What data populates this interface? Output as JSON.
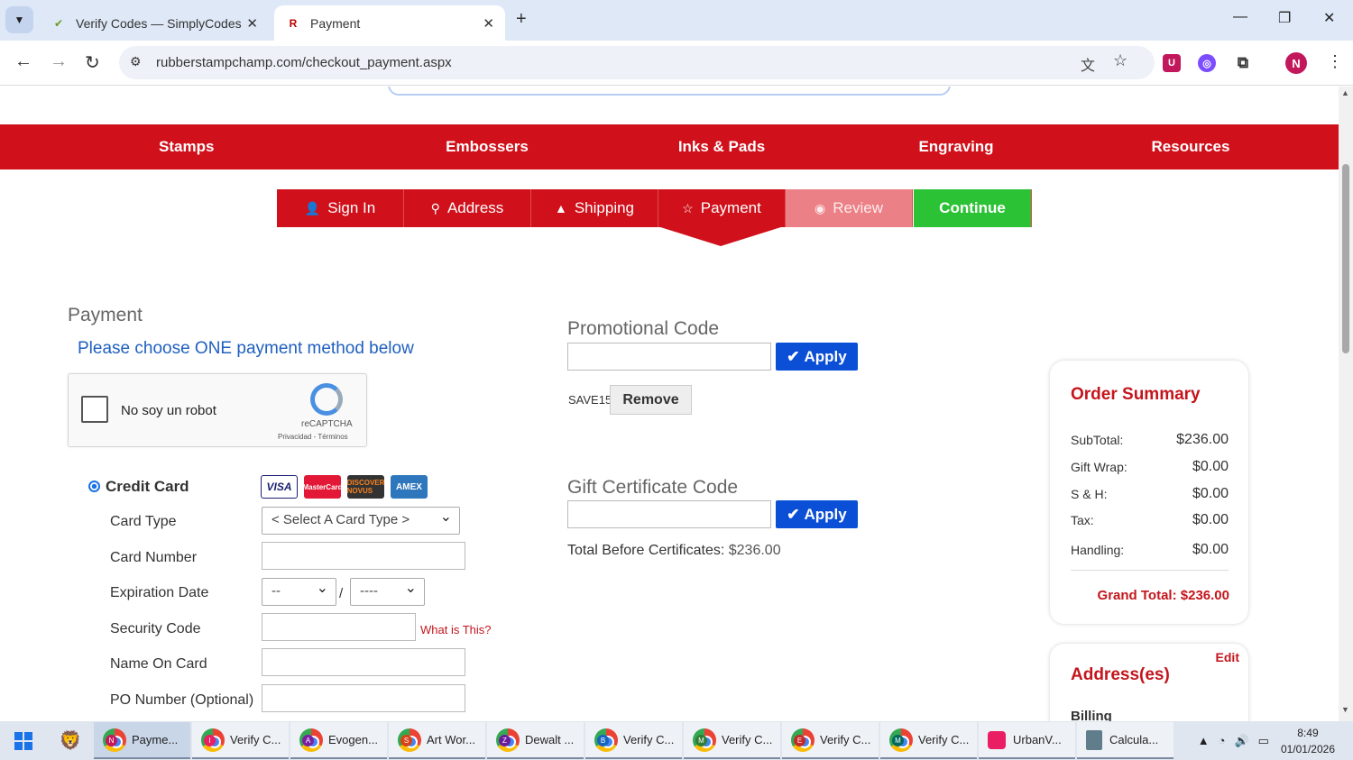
{
  "browser": {
    "tabs": [
      {
        "title": "Verify Codes — SimplyCodes",
        "active": false
      },
      {
        "title": "Payment",
        "active": true
      }
    ],
    "url": "rubberstampchamp.com/checkout_payment.aspx",
    "profile_initial": "N"
  },
  "nav": {
    "items": [
      "Stamps",
      "Embossers",
      "Inks & Pads",
      "Engraving",
      "Resources"
    ]
  },
  "steps": {
    "sign_in": "Sign In",
    "address": "Address",
    "shipping": "Shipping",
    "payment": "Payment",
    "review": "Review",
    "continue": "Continue"
  },
  "payment": {
    "heading": "Payment",
    "instruction": "Please choose ONE payment method below",
    "recaptcha_label": "No soy un robot",
    "recaptcha_brand": "reCAPTCHA",
    "recaptcha_links": "Privacidad - Términos",
    "credit_card_label": "Credit Card",
    "card_logos": [
      "VISA",
      "MasterCard",
      "DISCOVER NOVUS",
      "AMEX"
    ],
    "fields": {
      "card_type_label": "Card Type",
      "card_type_value": "< Select A Card Type >",
      "card_number_label": "Card Number",
      "expiration_label": "Expiration Date",
      "exp_month_value": "--",
      "exp_year_value": "----",
      "security_code_label": "Security Code",
      "what_is_this": "What is This?",
      "name_on_card_label": "Name On Card",
      "po_number_label": "PO Number (Optional)"
    }
  },
  "promo": {
    "heading": "Promotional Code",
    "apply_label": "Apply",
    "applied_code": "SAVE15",
    "remove_label": "Remove"
  },
  "gift": {
    "heading": "Gift Certificate Code",
    "apply_label": "Apply",
    "total_before_label": "Total Before Certificates:",
    "total_before_value": "$236.00"
  },
  "summary": {
    "heading": "Order Summary",
    "rows": [
      {
        "label": "SubTotal:",
        "value": "$236.00"
      },
      {
        "label": "Gift Wrap:",
        "value": "$0.00"
      },
      {
        "label": "S & H:",
        "value": "$0.00"
      },
      {
        "label": "Tax:",
        "value": "$0.00"
      },
      {
        "label": "Handling:",
        "value": "$0.00"
      }
    ],
    "grand_total": "Grand Total: $236.00"
  },
  "addresses": {
    "edit_label": "Edit",
    "heading": "Address(es)",
    "billing_label": "Billing"
  },
  "taskbar": {
    "items": [
      {
        "label": "Payme...",
        "badge": "N",
        "badge_color": "#c2185b"
      },
      {
        "label": "Verify C...",
        "badge": "I",
        "badge_color": "#e91e63"
      },
      {
        "label": "Evogen...",
        "badge": "A",
        "badge_color": "#7b1fa2"
      },
      {
        "label": "Art Wor...",
        "badge": "S",
        "badge_color": "#d84315"
      },
      {
        "label": "Dewalt ...",
        "badge": "Z",
        "badge_color": "#6a1b9a"
      },
      {
        "label": "Verify C...",
        "badge": "B",
        "badge_color": "#1565c0"
      },
      {
        "label": "Verify C...",
        "badge": "M",
        "badge_color": "#2e7d32"
      },
      {
        "label": "Verify C...",
        "badge": "E",
        "badge_color": "#c62828"
      },
      {
        "label": "Verify C...",
        "badge": "M",
        "badge_color": "#00695c"
      },
      {
        "label": "UrbanV...",
        "badge": "",
        "badge_color": "#e91e63"
      },
      {
        "label": "Calcula...",
        "badge": "",
        "badge_color": "#607d8b"
      }
    ],
    "time": "8:49",
    "date": "01/01/2026"
  }
}
